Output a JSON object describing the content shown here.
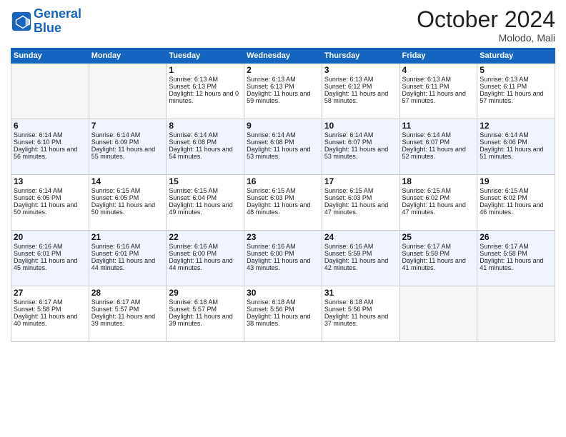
{
  "logo": {
    "line1": "General",
    "line2": "Blue"
  },
  "title": "October 2024",
  "location": "Molodo, Mali",
  "days_of_week": [
    "Sunday",
    "Monday",
    "Tuesday",
    "Wednesday",
    "Thursday",
    "Friday",
    "Saturday"
  ],
  "weeks": [
    [
      {
        "day": "",
        "empty": true
      },
      {
        "day": "",
        "empty": true
      },
      {
        "day": "1",
        "sunrise": "Sunrise: 6:13 AM",
        "sunset": "Sunset: 6:13 PM",
        "daylight": "Daylight: 12 hours and 0 minutes."
      },
      {
        "day": "2",
        "sunrise": "Sunrise: 6:13 AM",
        "sunset": "Sunset: 6:13 PM",
        "daylight": "Daylight: 11 hours and 59 minutes."
      },
      {
        "day": "3",
        "sunrise": "Sunrise: 6:13 AM",
        "sunset": "Sunset: 6:12 PM",
        "daylight": "Daylight: 11 hours and 58 minutes."
      },
      {
        "day": "4",
        "sunrise": "Sunrise: 6:13 AM",
        "sunset": "Sunset: 6:11 PM",
        "daylight": "Daylight: 11 hours and 57 minutes."
      },
      {
        "day": "5",
        "sunrise": "Sunrise: 6:13 AM",
        "sunset": "Sunset: 6:11 PM",
        "daylight": "Daylight: 11 hours and 57 minutes."
      }
    ],
    [
      {
        "day": "6",
        "sunrise": "Sunrise: 6:14 AM",
        "sunset": "Sunset: 6:10 PM",
        "daylight": "Daylight: 11 hours and 56 minutes."
      },
      {
        "day": "7",
        "sunrise": "Sunrise: 6:14 AM",
        "sunset": "Sunset: 6:09 PM",
        "daylight": "Daylight: 11 hours and 55 minutes."
      },
      {
        "day": "8",
        "sunrise": "Sunrise: 6:14 AM",
        "sunset": "Sunset: 6:08 PM",
        "daylight": "Daylight: 11 hours and 54 minutes."
      },
      {
        "day": "9",
        "sunrise": "Sunrise: 6:14 AM",
        "sunset": "Sunset: 6:08 PM",
        "daylight": "Daylight: 11 hours and 53 minutes."
      },
      {
        "day": "10",
        "sunrise": "Sunrise: 6:14 AM",
        "sunset": "Sunset: 6:07 PM",
        "daylight": "Daylight: 11 hours and 53 minutes."
      },
      {
        "day": "11",
        "sunrise": "Sunrise: 6:14 AM",
        "sunset": "Sunset: 6:07 PM",
        "daylight": "Daylight: 11 hours and 52 minutes."
      },
      {
        "day": "12",
        "sunrise": "Sunrise: 6:14 AM",
        "sunset": "Sunset: 6:06 PM",
        "daylight": "Daylight: 11 hours and 51 minutes."
      }
    ],
    [
      {
        "day": "13",
        "sunrise": "Sunrise: 6:14 AM",
        "sunset": "Sunset: 6:05 PM",
        "daylight": "Daylight: 11 hours and 50 minutes."
      },
      {
        "day": "14",
        "sunrise": "Sunrise: 6:15 AM",
        "sunset": "Sunset: 6:05 PM",
        "daylight": "Daylight: 11 hours and 50 minutes."
      },
      {
        "day": "15",
        "sunrise": "Sunrise: 6:15 AM",
        "sunset": "Sunset: 6:04 PM",
        "daylight": "Daylight: 11 hours and 49 minutes."
      },
      {
        "day": "16",
        "sunrise": "Sunrise: 6:15 AM",
        "sunset": "Sunset: 6:03 PM",
        "daylight": "Daylight: 11 hours and 48 minutes."
      },
      {
        "day": "17",
        "sunrise": "Sunrise: 6:15 AM",
        "sunset": "Sunset: 6:03 PM",
        "daylight": "Daylight: 11 hours and 47 minutes."
      },
      {
        "day": "18",
        "sunrise": "Sunrise: 6:15 AM",
        "sunset": "Sunset: 6:02 PM",
        "daylight": "Daylight: 11 hours and 47 minutes."
      },
      {
        "day": "19",
        "sunrise": "Sunrise: 6:15 AM",
        "sunset": "Sunset: 6:02 PM",
        "daylight": "Daylight: 11 hours and 46 minutes."
      }
    ],
    [
      {
        "day": "20",
        "sunrise": "Sunrise: 6:16 AM",
        "sunset": "Sunset: 6:01 PM",
        "daylight": "Daylight: 11 hours and 45 minutes."
      },
      {
        "day": "21",
        "sunrise": "Sunrise: 6:16 AM",
        "sunset": "Sunset: 6:01 PM",
        "daylight": "Daylight: 11 hours and 44 minutes."
      },
      {
        "day": "22",
        "sunrise": "Sunrise: 6:16 AM",
        "sunset": "Sunset: 6:00 PM",
        "daylight": "Daylight: 11 hours and 44 minutes."
      },
      {
        "day": "23",
        "sunrise": "Sunrise: 6:16 AM",
        "sunset": "Sunset: 6:00 PM",
        "daylight": "Daylight: 11 hours and 43 minutes."
      },
      {
        "day": "24",
        "sunrise": "Sunrise: 6:16 AM",
        "sunset": "Sunset: 5:59 PM",
        "daylight": "Daylight: 11 hours and 42 minutes."
      },
      {
        "day": "25",
        "sunrise": "Sunrise: 6:17 AM",
        "sunset": "Sunset: 5:59 PM",
        "daylight": "Daylight: 11 hours and 41 minutes."
      },
      {
        "day": "26",
        "sunrise": "Sunrise: 6:17 AM",
        "sunset": "Sunset: 5:58 PM",
        "daylight": "Daylight: 11 hours and 41 minutes."
      }
    ],
    [
      {
        "day": "27",
        "sunrise": "Sunrise: 6:17 AM",
        "sunset": "Sunset: 5:58 PM",
        "daylight": "Daylight: 11 hours and 40 minutes."
      },
      {
        "day": "28",
        "sunrise": "Sunrise: 6:17 AM",
        "sunset": "Sunset: 5:57 PM",
        "daylight": "Daylight: 11 hours and 39 minutes."
      },
      {
        "day": "29",
        "sunrise": "Sunrise: 6:18 AM",
        "sunset": "Sunset: 5:57 PM",
        "daylight": "Daylight: 11 hours and 39 minutes."
      },
      {
        "day": "30",
        "sunrise": "Sunrise: 6:18 AM",
        "sunset": "Sunset: 5:56 PM",
        "daylight": "Daylight: 11 hours and 38 minutes."
      },
      {
        "day": "31",
        "sunrise": "Sunrise: 6:18 AM",
        "sunset": "Sunset: 5:56 PM",
        "daylight": "Daylight: 11 hours and 37 minutes."
      },
      {
        "day": "",
        "empty": true
      },
      {
        "day": "",
        "empty": true
      }
    ]
  ]
}
